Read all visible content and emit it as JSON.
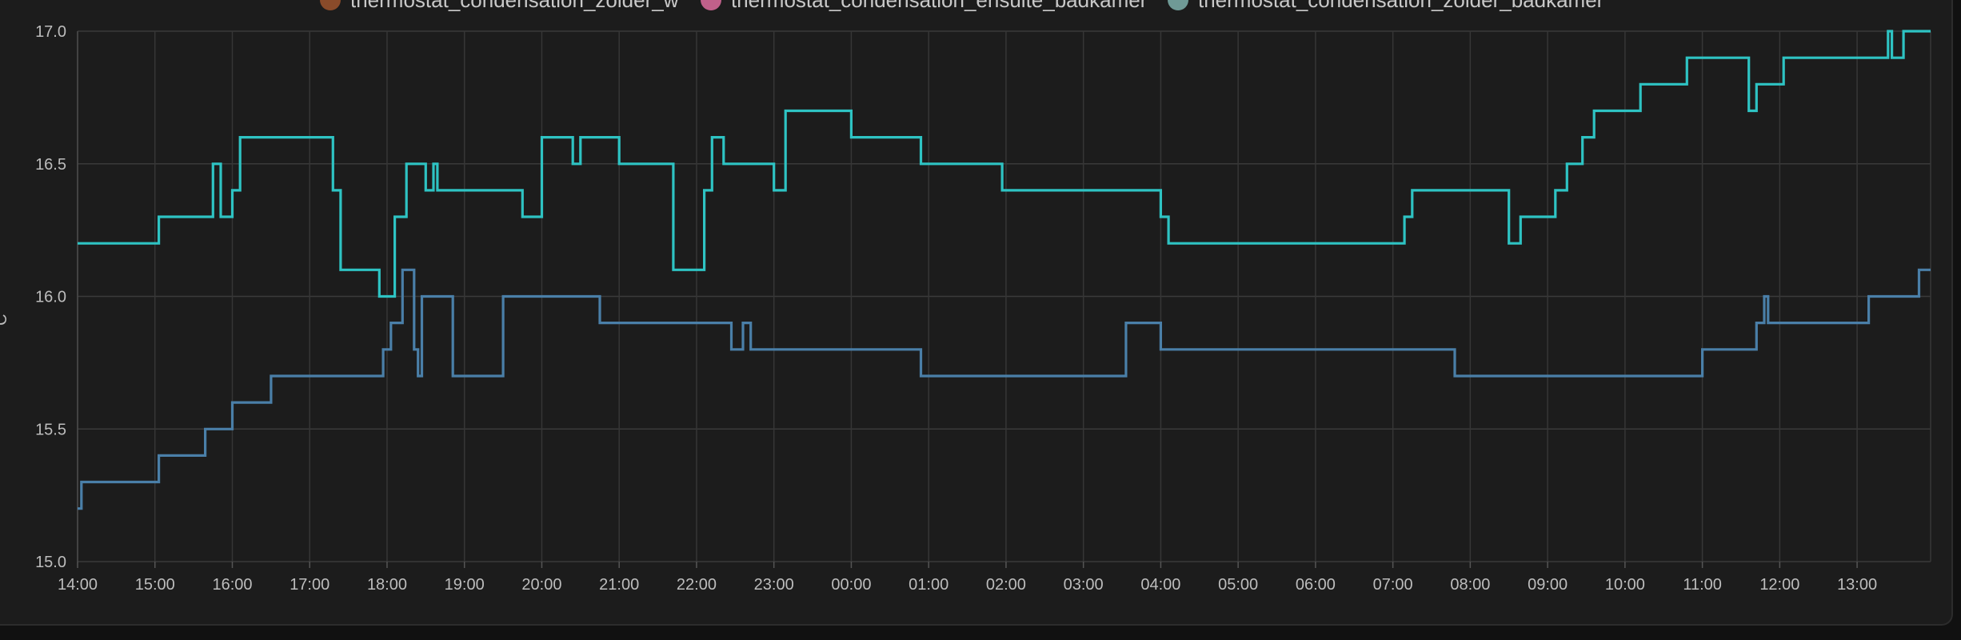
{
  "chart_data": {
    "type": "line",
    "title": "",
    "xlabel": "",
    "ylabel": "°C",
    "ylim": [
      15.0,
      17.0
    ],
    "y_ticks": [
      "15.0",
      "15.5",
      "16.0",
      "16.5",
      "17.0"
    ],
    "x_ticks": [
      "14:00",
      "15:00",
      "16:00",
      "17:00",
      "18:00",
      "19:00",
      "20:00",
      "21:00",
      "22:00",
      "23:00",
      "00:00",
      "01:00",
      "02:00",
      "03:00",
      "04:00",
      "05:00",
      "06:00",
      "07:00",
      "08:00",
      "09:00",
      "10:00",
      "11:00",
      "12:00",
      "13:00"
    ],
    "xlim_hours": [
      0,
      23.95
    ],
    "grid": true,
    "step": true,
    "legend_position": "top",
    "legend": [
      {
        "name": "thermostat_condensation_zolder_w",
        "color": "#8a4b2a"
      },
      {
        "name": "thermostat_condensation_ensuite_badkamer",
        "color": "#c0608a"
      },
      {
        "name": "thermostat_condensation_zolder_badkamer",
        "color": "#6f9a96"
      }
    ],
    "series": [
      {
        "color": "#2ec3c3",
        "points": [
          [
            0.0,
            16.2
          ],
          [
            1.05,
            16.3
          ],
          [
            1.75,
            16.5
          ],
          [
            1.85,
            16.3
          ],
          [
            2.0,
            16.4
          ],
          [
            2.1,
            16.6
          ],
          [
            3.3,
            16.4
          ],
          [
            3.4,
            16.1
          ],
          [
            3.9,
            16.0
          ],
          [
            4.1,
            16.3
          ],
          [
            4.25,
            16.5
          ],
          [
            4.5,
            16.4
          ],
          [
            4.6,
            16.5
          ],
          [
            4.65,
            16.4
          ],
          [
            5.75,
            16.3
          ],
          [
            6.0,
            16.6
          ],
          [
            6.4,
            16.5
          ],
          [
            6.5,
            16.6
          ],
          [
            7.0,
            16.5
          ],
          [
            7.7,
            16.1
          ],
          [
            8.1,
            16.4
          ],
          [
            8.2,
            16.6
          ],
          [
            8.35,
            16.5
          ],
          [
            9.0,
            16.4
          ],
          [
            9.15,
            16.7
          ],
          [
            10.0,
            16.6
          ],
          [
            10.9,
            16.5
          ],
          [
            11.95,
            16.4
          ],
          [
            14.0,
            16.3
          ],
          [
            14.1,
            16.2
          ],
          [
            17.15,
            16.3
          ],
          [
            17.25,
            16.4
          ],
          [
            18.5,
            16.2
          ],
          [
            18.65,
            16.3
          ],
          [
            19.1,
            16.4
          ],
          [
            19.25,
            16.5
          ],
          [
            19.45,
            16.6
          ],
          [
            19.6,
            16.7
          ],
          [
            20.2,
            16.8
          ],
          [
            20.8,
            16.9
          ],
          [
            21.6,
            16.7
          ],
          [
            21.7,
            16.8
          ],
          [
            22.05,
            16.9
          ],
          [
            23.4,
            17.0
          ],
          [
            23.45,
            16.9
          ],
          [
            23.6,
            17.0
          ],
          [
            23.95,
            17.0
          ]
        ]
      },
      {
        "color": "#4a7fa8",
        "points": [
          [
            0.0,
            15.2
          ],
          [
            0.05,
            15.3
          ],
          [
            1.05,
            15.4
          ],
          [
            1.65,
            15.5
          ],
          [
            2.0,
            15.6
          ],
          [
            2.5,
            15.7
          ],
          [
            3.95,
            15.8
          ],
          [
            4.05,
            15.9
          ],
          [
            4.2,
            16.1
          ],
          [
            4.35,
            15.8
          ],
          [
            4.4,
            15.7
          ],
          [
            4.45,
            16.0
          ],
          [
            4.85,
            15.7
          ],
          [
            5.5,
            16.0
          ],
          [
            6.75,
            15.9
          ],
          [
            8.45,
            15.8
          ],
          [
            8.6,
            15.9
          ],
          [
            8.7,
            15.8
          ],
          [
            10.9,
            15.7
          ],
          [
            13.55,
            15.9
          ],
          [
            14.0,
            15.8
          ],
          [
            17.8,
            15.7
          ],
          [
            21.0,
            15.8
          ],
          [
            21.7,
            15.9
          ],
          [
            21.8,
            16.0
          ],
          [
            21.85,
            15.9
          ],
          [
            23.15,
            16.0
          ],
          [
            23.8,
            16.1
          ],
          [
            23.95,
            16.1
          ]
        ]
      }
    ]
  }
}
